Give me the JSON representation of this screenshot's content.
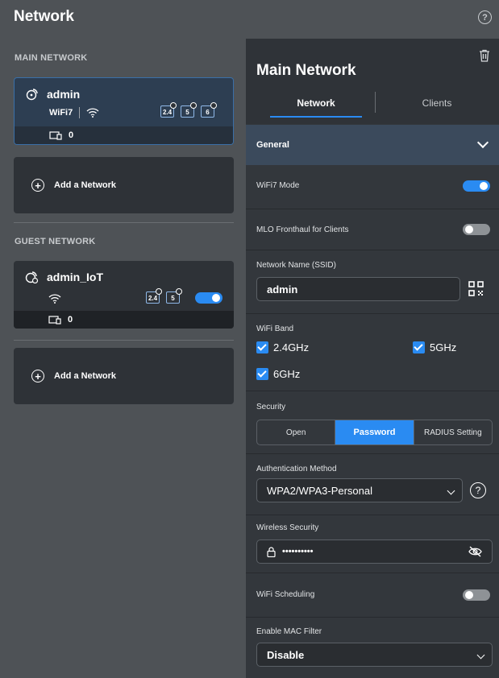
{
  "header": {
    "title": "Network",
    "help_icon": "help-circle-icon"
  },
  "left": {
    "main_section_title": "MAIN NETWORK",
    "main_network": {
      "name": "admin",
      "wifi_badge": "WiFi7",
      "bands": [
        "2.4",
        "5",
        "6"
      ],
      "clients": "0"
    },
    "add_network_label": "Add a Network",
    "guest_section_title": "GUEST NETWORK",
    "guest_network": {
      "name": "admin_IoT",
      "bands": [
        "2.4",
        "5"
      ],
      "clients": "0",
      "enabled": true
    },
    "add_guest_label": "Add a Network"
  },
  "panel": {
    "title": "Main Network",
    "tabs": [
      {
        "label": "Network",
        "active": true
      },
      {
        "label": "Clients",
        "active": false
      }
    ],
    "general_label": "General",
    "wifi7_mode": {
      "label": "WiFi7 Mode",
      "enabled": true
    },
    "mlo": {
      "label": "MLO Fronthaul for Clients",
      "enabled": false
    },
    "ssid": {
      "label": "Network Name (SSID)",
      "value": "admin"
    },
    "wifi_band": {
      "label": "WiFi Band",
      "options": [
        {
          "label": "2.4GHz",
          "checked": true
        },
        {
          "label": "5GHz",
          "checked": true
        },
        {
          "label": "6GHz",
          "checked": true
        }
      ]
    },
    "security": {
      "label": "Security",
      "options": [
        "Open",
        "Password",
        "RADIUS Setting"
      ],
      "selected": "Password"
    },
    "auth_method": {
      "label": "Authentication Method",
      "value": "WPA2/WPA3-Personal"
    },
    "wireless_security": {
      "label": "Wireless Security",
      "value": "••••••••••"
    },
    "wifi_scheduling": {
      "label": "WiFi Scheduling",
      "enabled": false
    },
    "mac_filter": {
      "label": "Enable MAC Filter",
      "value": "Disable"
    }
  },
  "colors": {
    "accent": "#2a8bf2",
    "background": "#4e5256",
    "panel": "#33373c"
  }
}
